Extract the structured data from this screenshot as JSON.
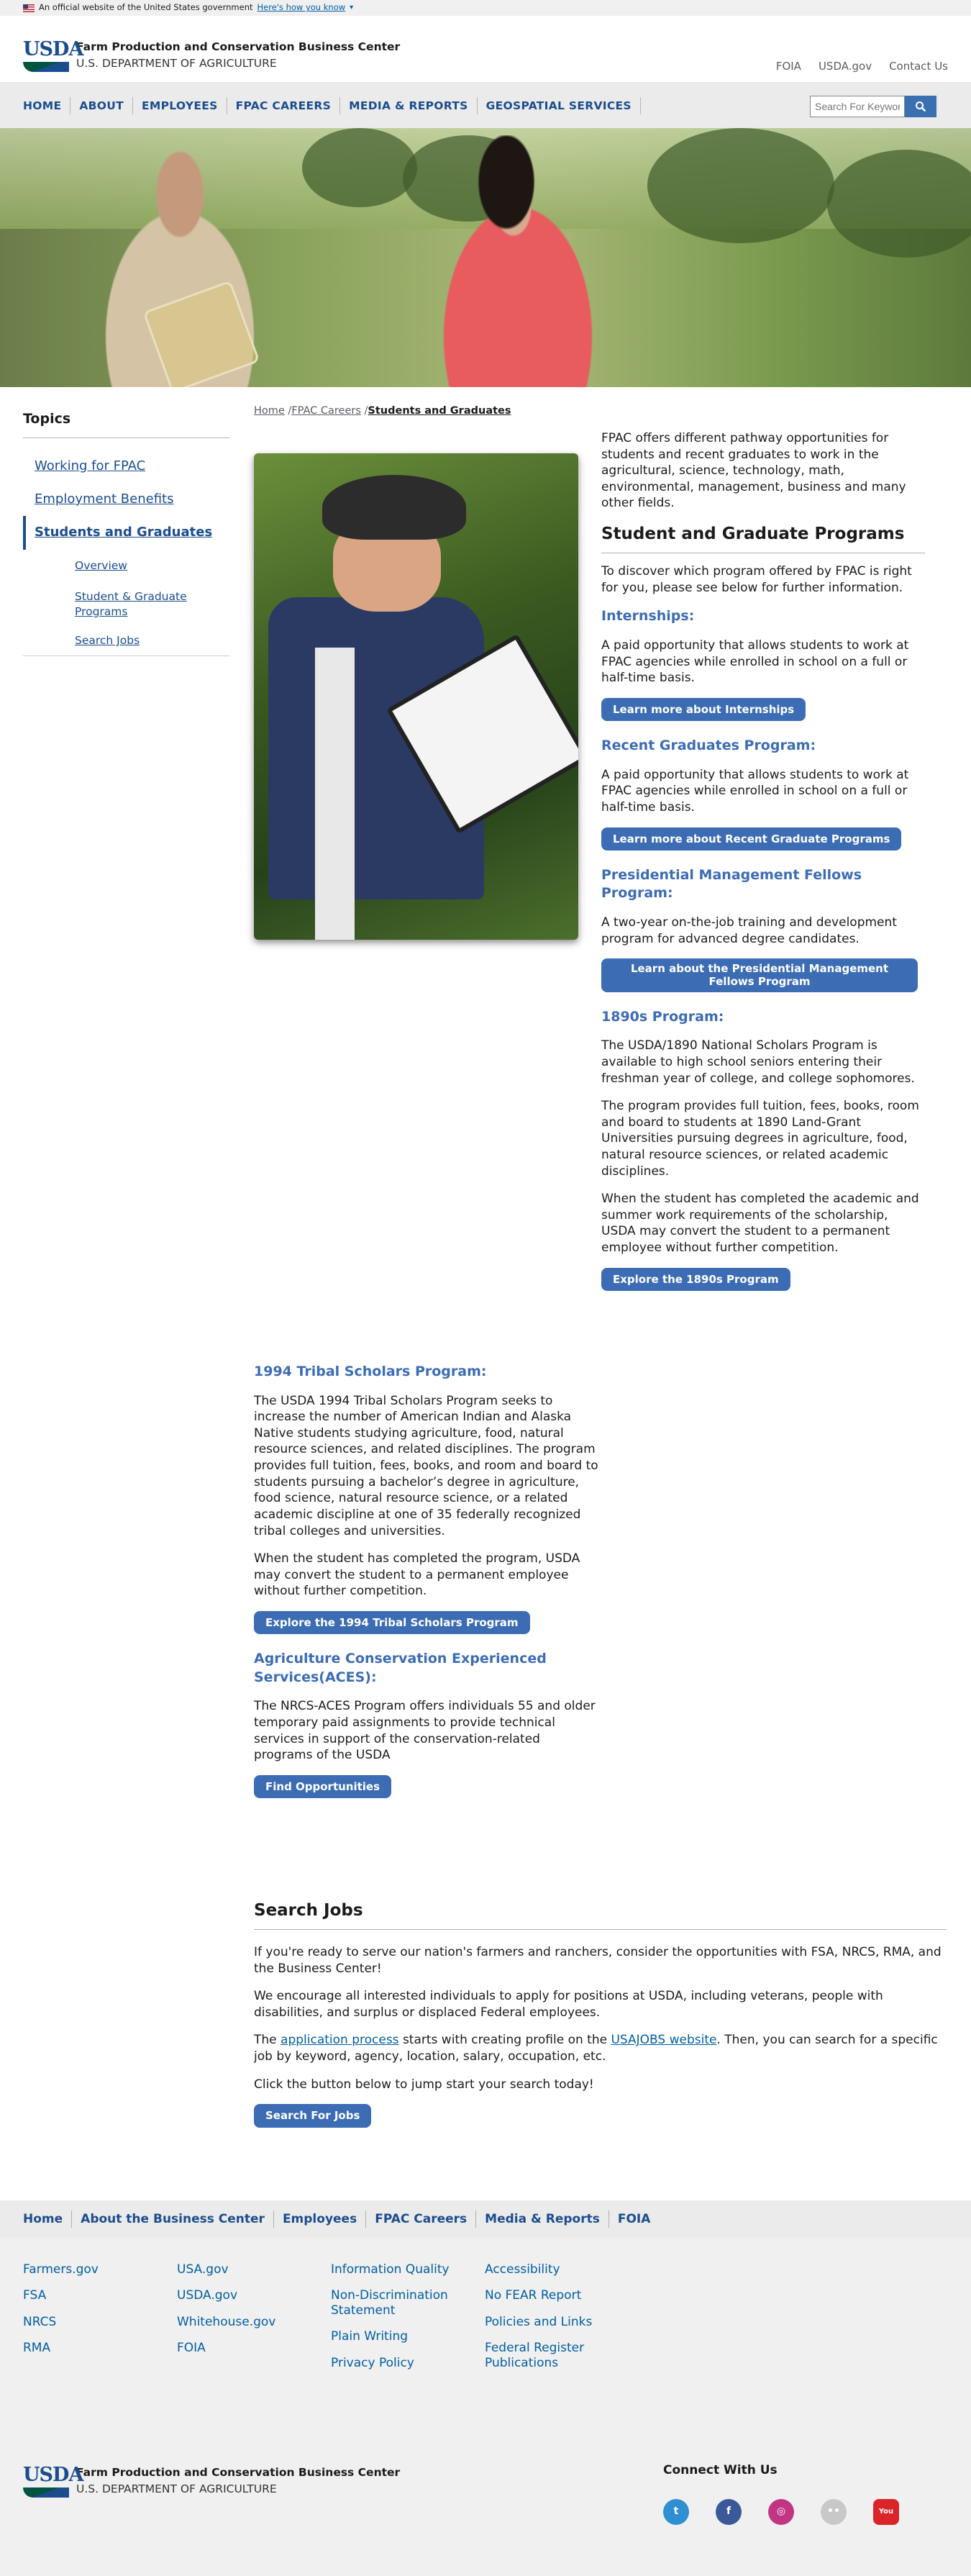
{
  "gov_banner": {
    "text": "An official website of the United States government",
    "link": "Here's how you know"
  },
  "header": {
    "agency": "Farm Production and Conservation Business Center",
    "department": "U.S. DEPARTMENT OF AGRICULTURE",
    "logo_mark": "USDA",
    "util_links": [
      "FOIA",
      "USDA.gov",
      "Contact Us"
    ]
  },
  "nav": {
    "items": [
      "HOME",
      "ABOUT",
      "EMPLOYEES",
      "FPAC CAREERS",
      "MEDIA & REPORTS",
      "GEOSPATIAL SERVICES"
    ],
    "search_placeholder": "Search For Keywords"
  },
  "sidebar": {
    "title": "Topics",
    "links": [
      "Working for FPAC",
      "Employment Benefits",
      "Students and Graduates"
    ],
    "sublinks": [
      "Overview",
      "Student & Graduate Programs",
      "Search Jobs"
    ]
  },
  "breadcrumb": {
    "home": "Home",
    "careers": "FPAC Careers",
    "current": "Students and Graduates"
  },
  "main": {
    "intro": "FPAC offers different pathway opportunities for students and recent graduates to work in the agricultural, science, technology, math, environmental, management, business and many other fields.",
    "programs_heading": "Student and Graduate Programs",
    "programs_intro": "To discover which program offered by FPAC is right for you, please see below for further information.",
    "internships": {
      "title": "Internships:",
      "text": "A paid opportunity that allows students to work at FPAC agencies while enrolled in school on a full or half-time basis.",
      "button": "Learn more about Internships"
    },
    "recent_grads": {
      "title": "Recent Graduates Program:",
      "text": "A paid opportunity that allows students to work at FPAC agencies while enrolled in school on a full or half-time basis.",
      "button": "Learn more about Recent Graduate Programs"
    },
    "pmf": {
      "title": "Presidential Management Fellows Program:",
      "text": "A two-year on-the-job training and development program for advanced degree candidates.",
      "button": "Learn about the Presidential Management Fellows Program"
    },
    "p1890": {
      "title": "1890s Program:",
      "p1": "The USDA/1890 National Scholars Program is available to high school seniors entering their freshman year of college, and college sophomores.",
      "p2": "The program provides full tuition, fees, books, room and board to students at 1890 Land-Grant Universities pursuing degrees in agriculture, food, natural resource sciences, or related academic disciplines.",
      "p3": "When the student has completed the academic and summer work requirements of the scholarship, USDA may convert the student to a permanent employee without further competition.",
      "button": "Explore the 1890s Program"
    },
    "tribal": {
      "title": "1994 Tribal Scholars Program:",
      "p1": "The USDA 1994 Tribal Scholars Program seeks to increase the number of American Indian and Alaska Native students studying agriculture, food, natural resource sciences, and related disciplines. The program provides full tuition, fees, books, and room and board to students pursuing a bachelor’s degree in agriculture, food science, natural resource science, or a related academic discipline at one of 35 federally recognized tribal colleges and universities.",
      "p2": "When the student has completed the program, USDA may convert the student to a permanent employee without further competition.",
      "button": "Explore the 1994 Tribal Scholars Program"
    },
    "aces": {
      "title": "Agriculture Conservation Experienced Services(ACES):",
      "text": "The NRCS-ACES Program offers individuals 55 and older temporary paid assignments to provide technical services in support of the conservation-related programs of the USDA",
      "button": "Find Opportunities"
    }
  },
  "search_jobs": {
    "heading": "Search Jobs",
    "p1": "If you're ready to serve our nation's farmers and ranchers, consider the opportunities with FSA, NRCS, RMA, and the Business Center!",
    "p2": "We encourage all interested individuals to apply for positions at USDA, including veterans, people with disabilities, and surplus or displaced Federal employees.",
    "p3_a": "The ",
    "p3_link1": "application process",
    "p3_b": " starts with creating profile on the ",
    "p3_link2": "USAJOBS website",
    "p3_c": ". Then, you can search for a specific job by keyword, agency, location, salary, occupation, etc.",
    "p4": "Click the button below to jump start your search today!",
    "button": "Search For Jobs"
  },
  "footer_nav": [
    "Home",
    "About the Business Center",
    "Employees",
    "FPAC Careers",
    "Media & Reports",
    "FOIA"
  ],
  "footer": {
    "col1": [
      "Farmers.gov",
      "FSA",
      "NRCS",
      "RMA"
    ],
    "col2": [
      "USA.gov",
      "USDA.gov",
      "Whitehouse.gov",
      "FOIA"
    ],
    "col3": [
      "Information Quality",
      "Non-Discrimination Statement",
      "Plain Writing",
      "Privacy Policy"
    ],
    "col4": [
      "Accessibility",
      "No FEAR Report",
      "Policies and Links",
      "Federal Register Publications"
    ],
    "connect": "Connect With Us",
    "social": [
      {
        "name": "twitter-icon",
        "glyph": "t",
        "color": "#2e8fd3"
      },
      {
        "name": "facebook-icon",
        "glyph": "f",
        "color": "#3b5998"
      },
      {
        "name": "instagram-icon",
        "glyph": "◎",
        "color": "#c13584"
      },
      {
        "name": "flickr-icon",
        "glyph": "••",
        "color": "#c8c8c8"
      },
      {
        "name": "youtube-icon",
        "glyph": "You",
        "color": "#d9252a"
      }
    ]
  }
}
